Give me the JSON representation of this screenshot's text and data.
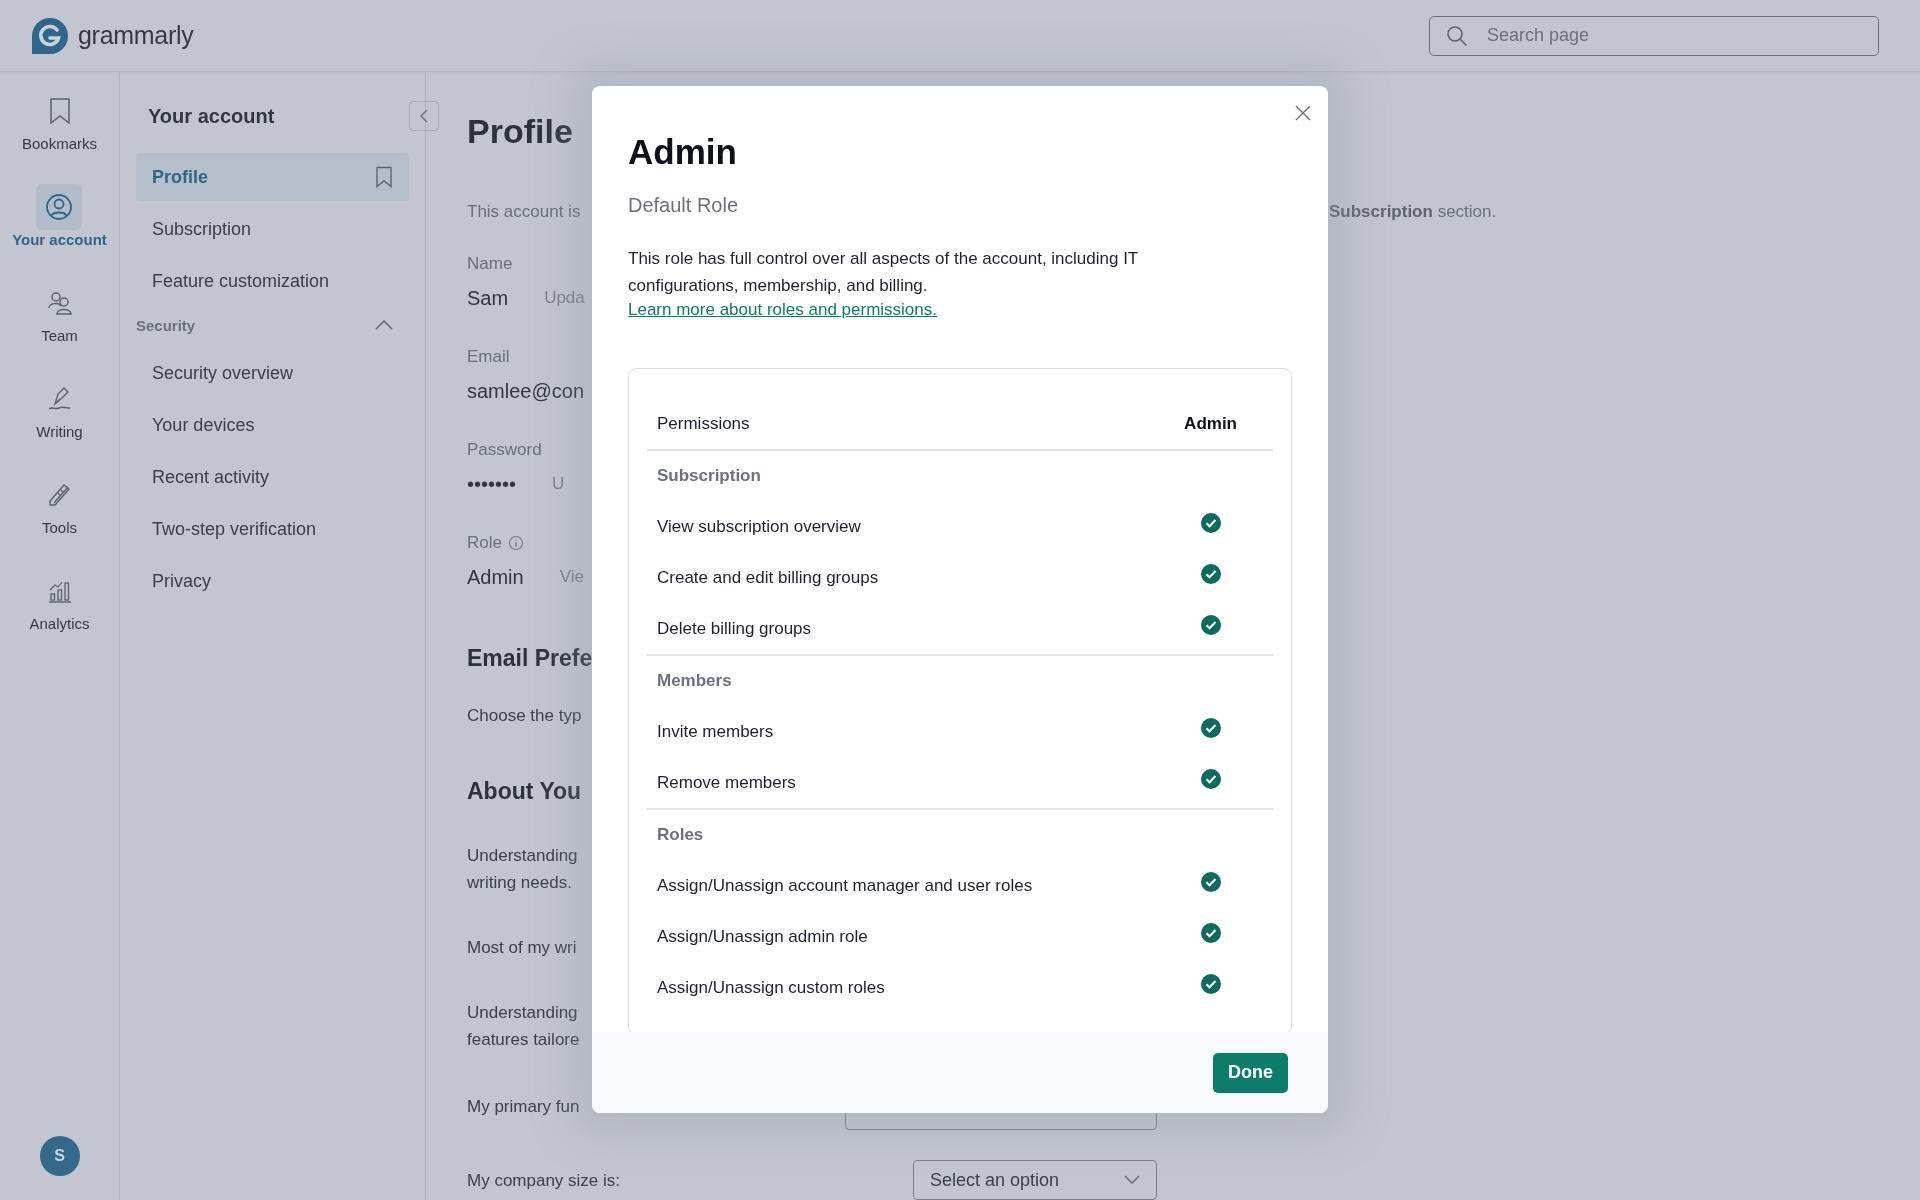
{
  "app": {
    "logo_text": "grammarly"
  },
  "search": {
    "placeholder": "Search page"
  },
  "rail": [
    {
      "kind": "bookmark",
      "label": "Bookmarks",
      "selected": false
    },
    {
      "kind": "account",
      "label": "Your account",
      "selected": true
    },
    {
      "kind": "team",
      "label": "Team",
      "selected": false
    },
    {
      "kind": "writing",
      "label": "Writing",
      "selected": false
    },
    {
      "kind": "tools",
      "label": "Tools",
      "selected": false
    },
    {
      "kind": "analytics",
      "label": "Analytics",
      "selected": false
    }
  ],
  "avatar": {
    "initial": "S"
  },
  "sidebar": {
    "title": "Your account",
    "items": [
      {
        "label": "Profile",
        "selected": true
      },
      {
        "label": "Subscription",
        "selected": false
      },
      {
        "label": "Feature customization",
        "selected": false
      }
    ],
    "section": {
      "label": "Security",
      "expanded": true,
      "items": [
        {
          "label": "Security overview",
          "selected": false
        },
        {
          "label": "Your devices",
          "selected": false
        },
        {
          "label": "Recent activity",
          "selected": false
        },
        {
          "label": "Two-step verification",
          "selected": false
        },
        {
          "label": "Privacy",
          "selected": false
        }
      ]
    }
  },
  "profile": {
    "title": "Profile",
    "intro_start": "This account is",
    "intro_end": "**Subscription** section.",
    "fields": [
      {
        "label": "Name",
        "value": "Sam",
        "action": "Upda"
      },
      {
        "label": "Email",
        "value": "samlee@con"
      },
      {
        "label": "Password",
        "value": "•••••••",
        "action": "U"
      },
      {
        "label": "Role",
        "value": "Admin",
        "action": "Vie",
        "info": true
      }
    ],
    "email_prefs": {
      "heading": "Email Prefe",
      "text": "Choose the typ"
    },
    "about": {
      "heading": "About You",
      "paragraphs": [
        [
          "Understanding",
          "writing needs."
        ],
        [
          "Most of my wri"
        ],
        [
          "Understanding",
          "features tailore"
        ]
      ]
    },
    "questions": [
      {
        "label": "My primary fun"
      },
      {
        "label": "My company size is:",
        "placeholder": "Select an option"
      }
    ]
  },
  "modal": {
    "title": "Admin",
    "subtitle": "Default Role",
    "description": "This role has full control over all aspects of the account, including IT configurations, membership, and billing.",
    "link": "Learn more about roles and permissions.",
    "table": {
      "columns": [
        "Permissions",
        "Admin"
      ],
      "groups": [
        {
          "name": "Subscription",
          "rows": [
            {
              "label": "View subscription overview",
              "allowed": true
            },
            {
              "label": "Create and edit billing groups",
              "allowed": true
            },
            {
              "label": "Delete billing groups",
              "allowed": true
            }
          ]
        },
        {
          "name": "Members",
          "rows": [
            {
              "label": "Invite members",
              "allowed": true
            },
            {
              "label": "Remove members",
              "allowed": true
            }
          ]
        },
        {
          "name": "Roles",
          "rows": [
            {
              "label": "Assign/Unassign account manager and user roles",
              "allowed": true
            },
            {
              "label": "Assign/Unassign admin role",
              "allowed": true
            },
            {
              "label": "Assign/Unassign custom roles",
              "allowed": true
            }
          ]
        }
      ]
    },
    "done": "Done"
  }
}
